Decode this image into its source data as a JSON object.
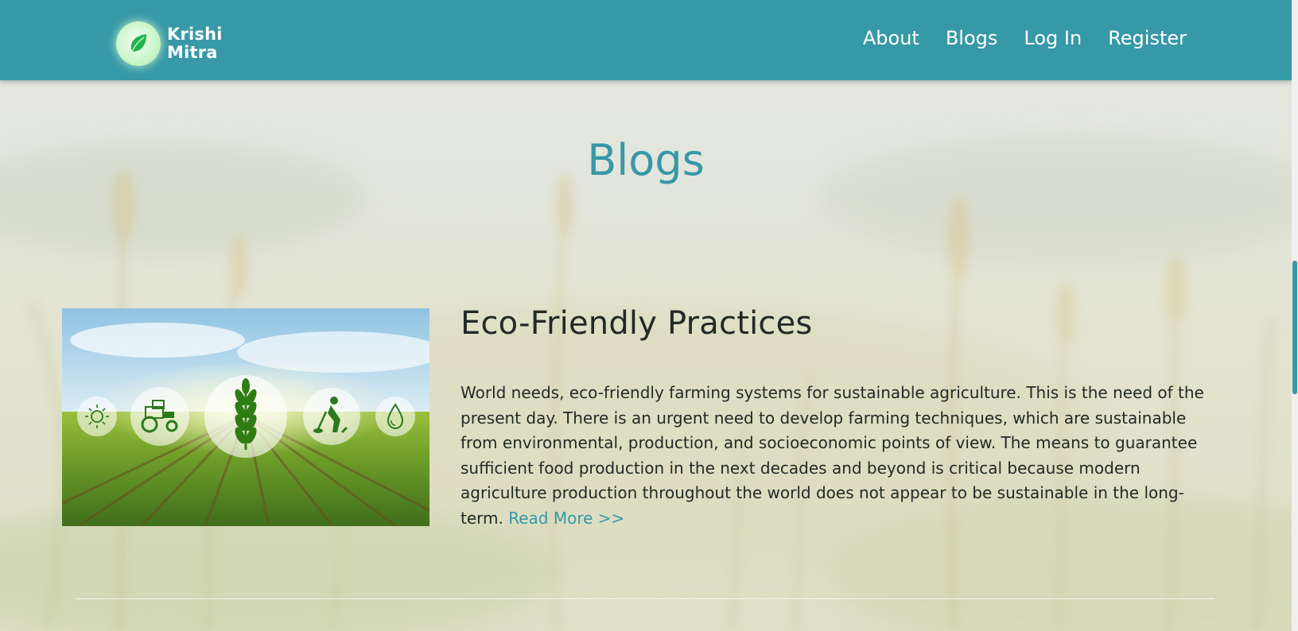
{
  "navbar": {
    "brand": {
      "line1": "Krishi",
      "line2": "Mitra",
      "logo_icon": "leaf-icon"
    },
    "links": [
      {
        "label": "About"
      },
      {
        "label": "Blogs"
      },
      {
        "label": "Log In"
      },
      {
        "label": "Register"
      }
    ]
  },
  "main": {
    "title": "Blogs",
    "posts": [
      {
        "title": "Eco-Friendly Practices",
        "body": "World needs, eco-friendly farming systems for sustainable agriculture. This is the need of the present day. There is an urgent need to develop farming techniques, which are sustainable from environmental, production, and socioeconomic points of view. The means to guarantee sufficient food production in the next decades and beyond is critical because modern agriculture production throughout the world does not appear to be sustainable in the long-term.",
        "read_more": "Read More >>",
        "image_icons": [
          "sun-icon",
          "tractor-icon",
          "wheat-icon",
          "farmer-icon",
          "water-drop-icon"
        ]
      }
    ]
  },
  "colors": {
    "primary": "#3798a7",
    "text": "#222a26",
    "background": "#e4e6dc"
  }
}
